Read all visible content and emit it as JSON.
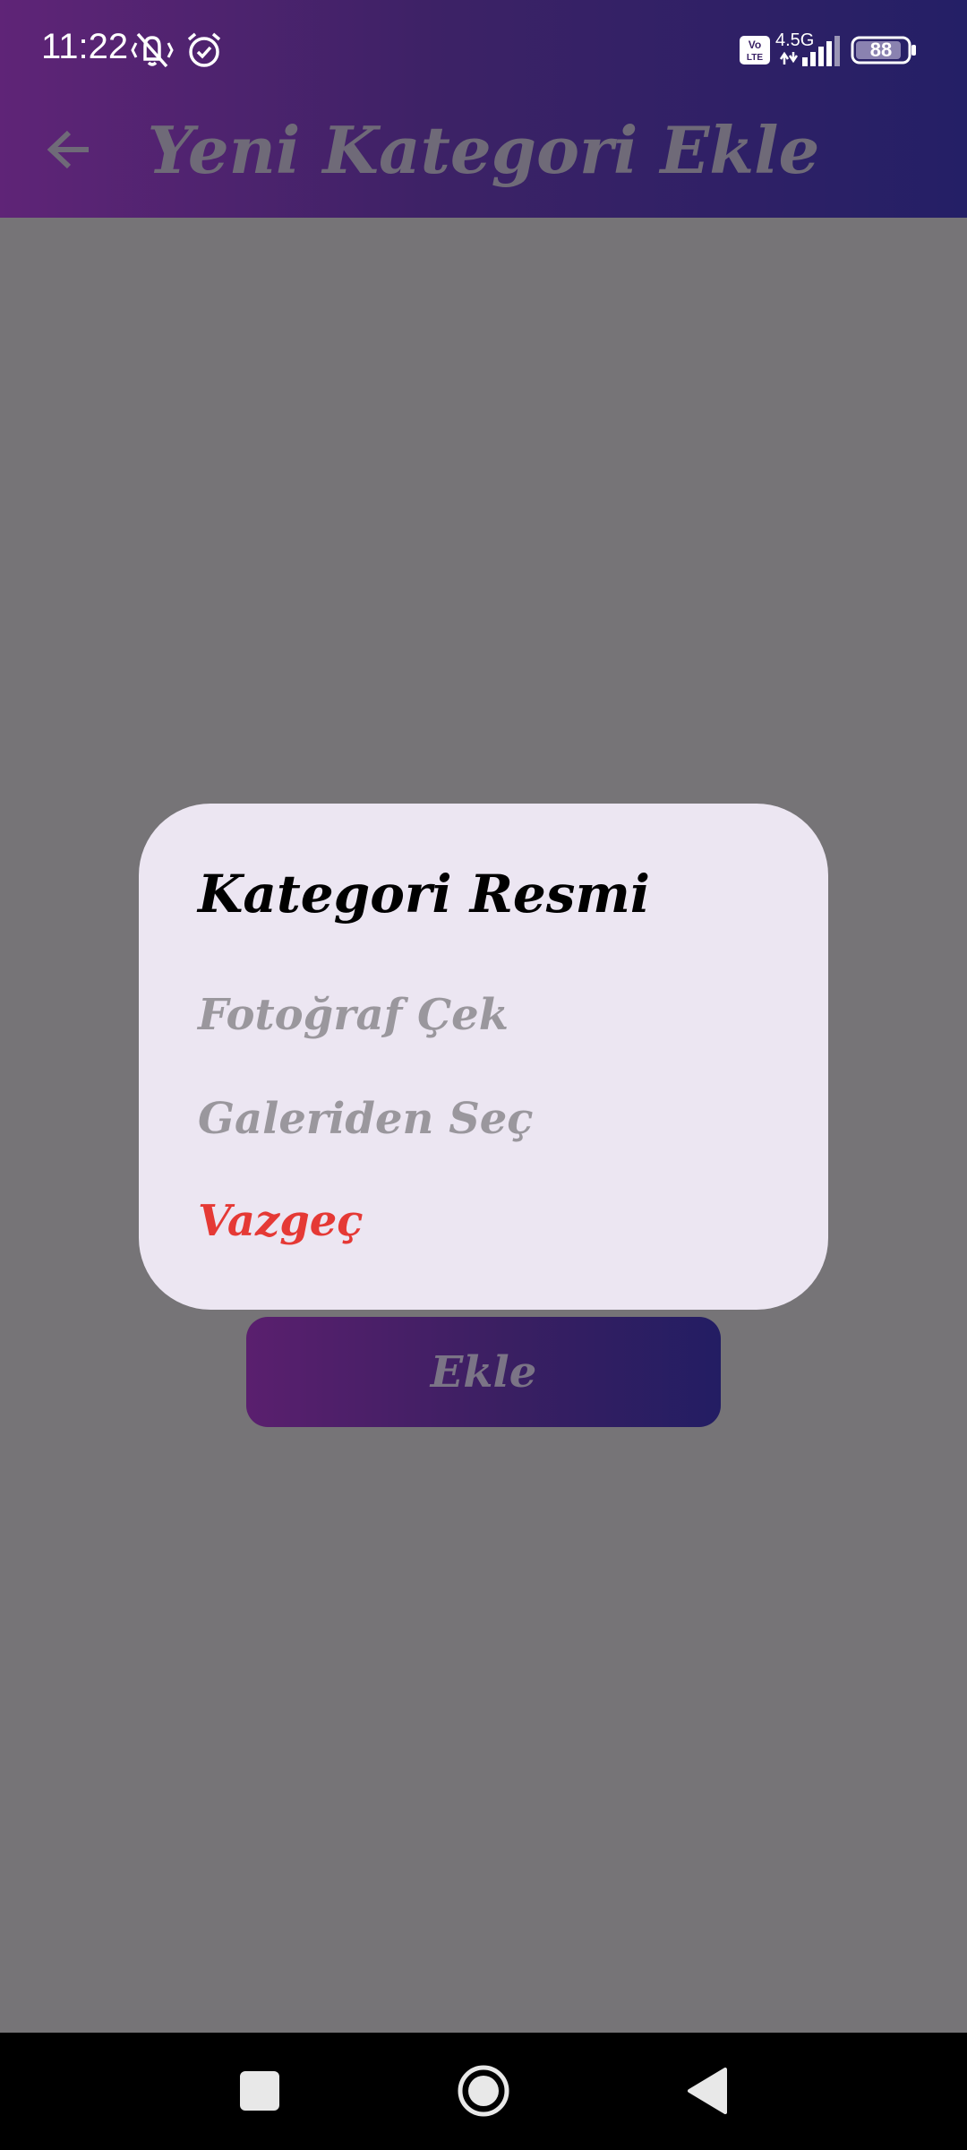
{
  "status_bar": {
    "time": "11:22",
    "network_label": "4.5G",
    "volte_label": "Vo LTE",
    "battery": "88",
    "icons": [
      "vibrate-muted-icon",
      "alarm-icon",
      "volte-icon",
      "signal-icon",
      "battery-icon"
    ]
  },
  "app_bar": {
    "title": "Yeni Kategori Ekle",
    "back_icon": "arrow-back-icon"
  },
  "dialog": {
    "title": "Kategori Resmi",
    "options": [
      {
        "label": "Fotoğraf Çek"
      },
      {
        "label": "Galeriden Seç"
      },
      {
        "label": "Vazgeç"
      }
    ]
  },
  "main": {
    "add_button_label": "Ekle"
  },
  "nav_bar": {
    "icons": [
      "recents-square-icon",
      "home-circle-icon",
      "back-triangle-icon"
    ]
  },
  "colors": {
    "header_gradient_start": "#5f2477",
    "header_gradient_end": "#241f66",
    "scrim": "#767477",
    "dialog_bg": "#ece6f2",
    "cancel_red": "#e53935"
  }
}
